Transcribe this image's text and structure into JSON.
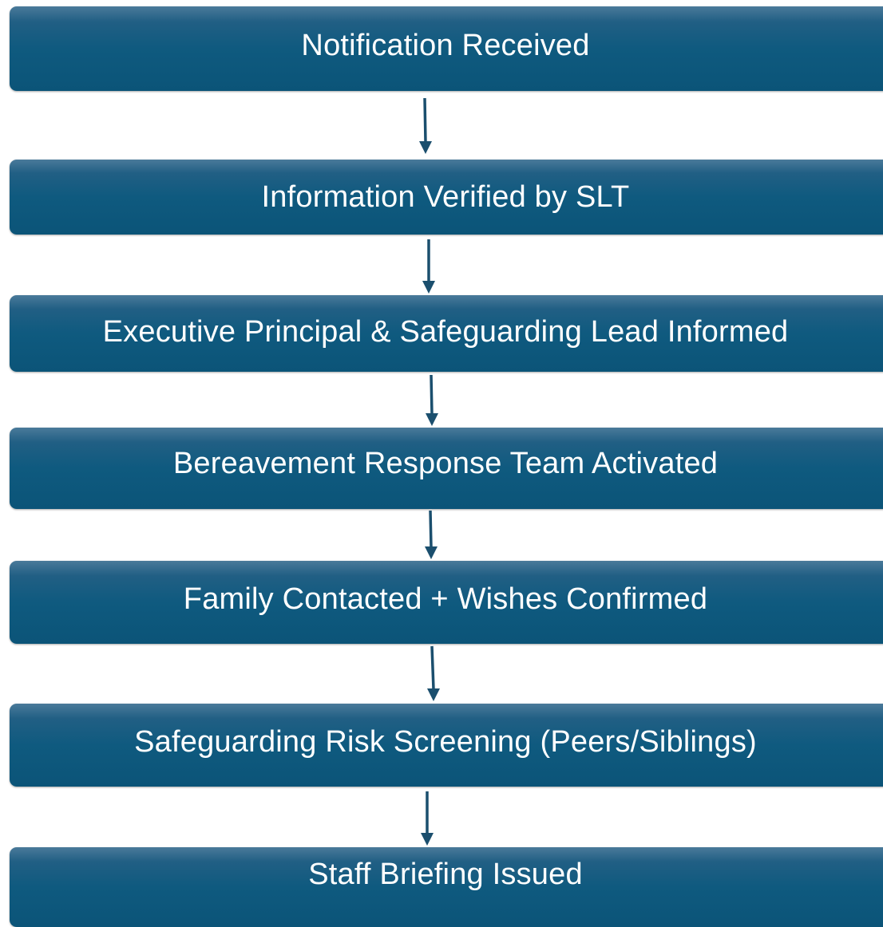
{
  "flowchart": {
    "steps": [
      {
        "label": "Notification Received"
      },
      {
        "label": "Information Verified by SLT"
      },
      {
        "label": "Executive Principal & Safeguarding Lead Informed"
      },
      {
        "label": "Bereavement Response Team Activated"
      },
      {
        "label": "Family Contacted + Wishes Confirmed"
      },
      {
        "label": "Safeguarding Risk Screening (Peers/Siblings)"
      },
      {
        "label": "Staff Briefing Issued"
      }
    ]
  },
  "colors": {
    "box_fill": "#0f5a7f",
    "box_text": "#ffffff",
    "arrow": "#1b4f6e"
  }
}
